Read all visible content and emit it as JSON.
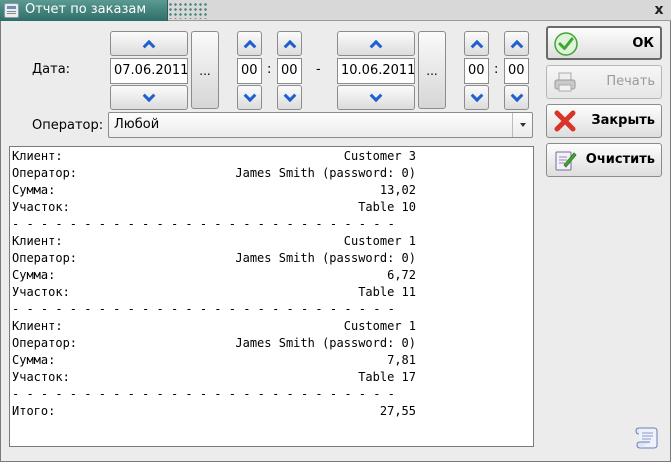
{
  "window": {
    "title": "Отчет по заказам",
    "close_glyph": "x"
  },
  "filters": {
    "date_label": "Дата:",
    "date_from": "07.06.2011",
    "hour_from": "00",
    "minute_from": "00",
    "date_to": "10.06.2011",
    "hour_to": "00",
    "minute_to": "00",
    "time_separator": ":",
    "range_separator": "-",
    "picker_label": "...",
    "operator_label": "Оператор:",
    "operator_value": "Любой"
  },
  "report": {
    "separator": "- - - - - - - - - - - - - - - - - - - - - - - - - - -",
    "orders": [
      {
        "client_label": "Клиент:",
        "client": "Customer 3",
        "operator_label": "Оператор:",
        "operator": "James Smith (password: 0)",
        "sum_label": "Сумма:",
        "sum": "13,02",
        "area_label": "Участок:",
        "area": "Table 10"
      },
      {
        "client_label": "Клиент:",
        "client": "Customer 1",
        "operator_label": "Оператор:",
        "operator": "James Smith (password: 0)",
        "sum_label": "Сумма:",
        "sum": "6,72",
        "area_label": "Участок:",
        "area": "Table 11"
      },
      {
        "client_label": "Клиент:",
        "client": "Customer 1",
        "operator_label": "Оператор:",
        "operator": "James Smith (password: 0)",
        "sum_label": "Сумма:",
        "sum": "7,81",
        "area_label": "Участок:",
        "area": "Table 17"
      }
    ],
    "total_label": "Итого:",
    "total": "27,55"
  },
  "actions": {
    "ok": "ОК",
    "print": "Печать",
    "close": "Закрыть",
    "clear": "Очистить"
  },
  "icons": {
    "ok": "check-circle-icon",
    "print": "printer-icon",
    "close": "red-x-icon",
    "clear": "clipboard-edit-icon",
    "bottom": "scroll-document-icon"
  },
  "colors": {
    "title_bar": "#3d7f78",
    "chevron": "#1f5fd0",
    "ok_green": "#3fa535",
    "close_red": "#d9342a"
  }
}
